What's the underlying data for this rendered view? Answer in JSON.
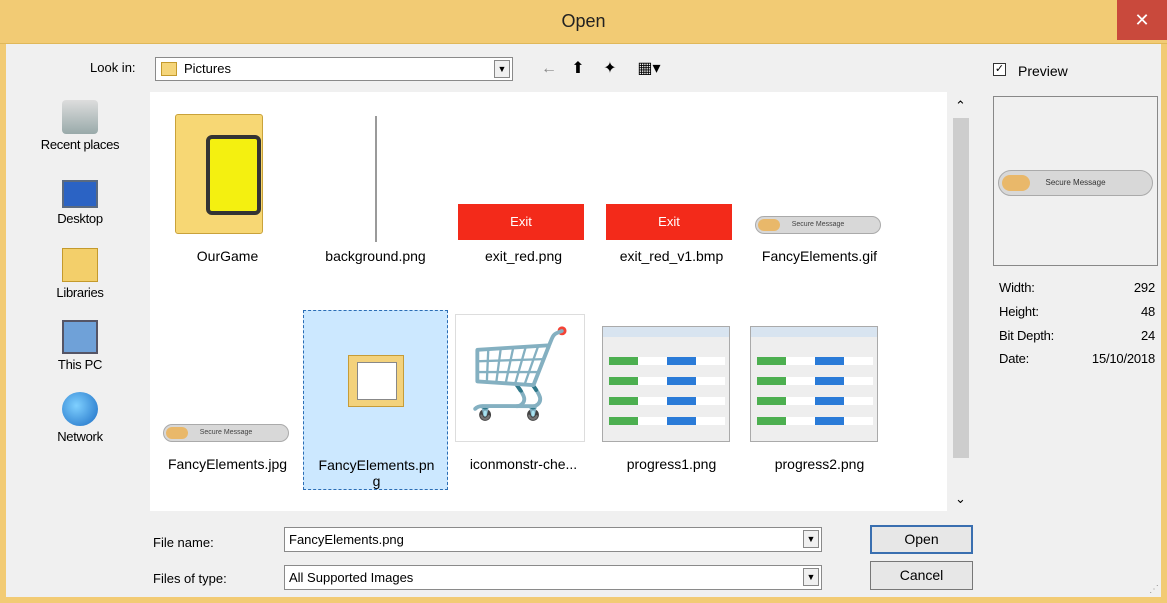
{
  "window": {
    "title": "Open",
    "close_glyph": "✕"
  },
  "lookin": {
    "label": "Look in:",
    "value": "Pictures"
  },
  "places": [
    {
      "label": "Recent places",
      "icon": "recent-places-icon"
    },
    {
      "label": "Desktop",
      "icon": "desktop-icon"
    },
    {
      "label": "Libraries",
      "icon": "libraries-icon"
    },
    {
      "label": "This PC",
      "icon": "this-pc-icon"
    },
    {
      "label": "Network",
      "icon": "network-icon"
    }
  ],
  "files": [
    {
      "name": "OurGame",
      "kind": "folder"
    },
    {
      "name": "background.png",
      "kind": "line"
    },
    {
      "name": "exit_red.png",
      "kind": "exit",
      "thumb_text": "Exit"
    },
    {
      "name": "exit_red_v1.bmp",
      "kind": "exit",
      "thumb_text": "Exit"
    },
    {
      "name": "FancyElements.gif",
      "kind": "fancy",
      "thumb_text": "Secure Message"
    },
    {
      "name": "FancyElements.jpg",
      "kind": "fancy",
      "thumb_text": "Secure Message"
    },
    {
      "name": "FancyElements.pn",
      "name_line2": "g",
      "kind": "png-icon",
      "selected": true
    },
    {
      "name": "iconmonstr-che...",
      "kind": "cart"
    },
    {
      "name": "progress1.png",
      "kind": "progress"
    },
    {
      "name": "progress2.png",
      "kind": "progress"
    }
  ],
  "preview": {
    "checkbox_label": "Preview",
    "checked": true,
    "thumb_text": "Secure Message",
    "info": [
      {
        "key": "Width:",
        "value": "292"
      },
      {
        "key": "Height:",
        "value": "48"
      },
      {
        "key": "Bit Depth:",
        "value": "24"
      },
      {
        "key": "Date:",
        "value": "15/10/2018"
      }
    ]
  },
  "filename": {
    "label": "File name:",
    "value": "FancyElements.png"
  },
  "filetype": {
    "label": "Files of type:",
    "value": "All Supported Images"
  },
  "buttons": {
    "open": "Open",
    "cancel": "Cancel"
  },
  "colors": {
    "titlebar": "#f2cb74",
    "close": "#c9493c",
    "selection": "#cce8ff",
    "exit": "#f32a1a"
  }
}
